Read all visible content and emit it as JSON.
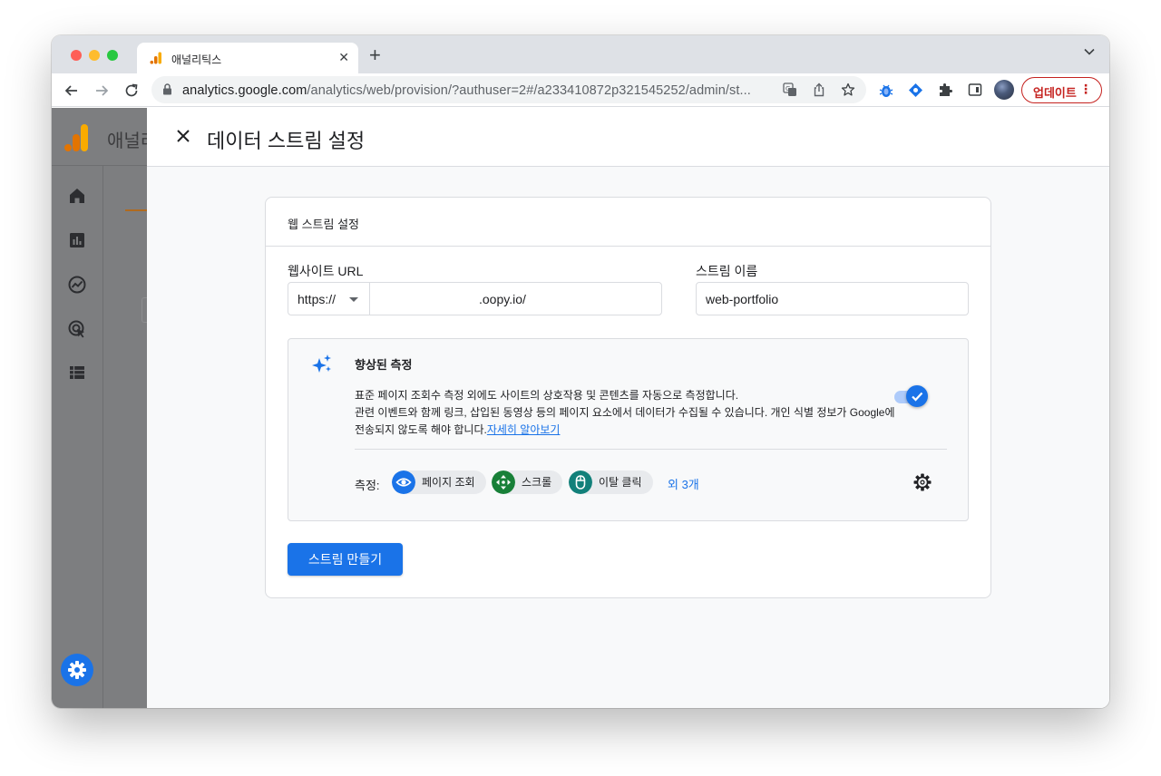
{
  "browser": {
    "tab_title": "애널리틱스",
    "url_host": "analytics.google.com",
    "url_path": "/analytics/web/provision/?authuser=2#/a233410872p321545252/admin/st...",
    "update_label": "업데이트",
    "update_menu": "⋮"
  },
  "background_app": {
    "title": "애널리"
  },
  "dialog": {
    "title": "데이터 스트림 설정",
    "card_title": "웹 스트림 설정",
    "url_label": "웹사이트 URL",
    "protocol": "https://",
    "url_value": ".oopy.io/",
    "name_label": "스트림 이름",
    "name_value": "web-portfolio",
    "enhanced": {
      "title": "향상된 측정",
      "desc_line1": "표준 페이지 조회수 측정 외에도 사이트의 상호작용 및 콘텐츠를 자동으로 측정합니다.",
      "desc_line2": "관련 이벤트와 함께 링크, 삽입된 동영상 등의 페이지 요소에서 데이터가 수집될 수 있습니다. 개인 식별 정보가 Google에",
      "desc_line3": "전송되지 않도록 해야 합니다.",
      "learn_more": "자세히 알아보기",
      "toggle_on": true,
      "measure_label": "측정:",
      "chips": [
        {
          "label": "페이지 조회",
          "icon": "eye-icon",
          "color": "#1a73e8"
        },
        {
          "label": "스크롤",
          "icon": "scroll-icon",
          "color": "#188038"
        },
        {
          "label": "이탈 클릭",
          "icon": "mouse-icon",
          "color": "#12807a"
        }
      ],
      "more": "외 3개"
    },
    "create_button": "스트림 만들기"
  },
  "colors": {
    "accent": "#1a73e8",
    "update_red": "#c5221f"
  }
}
